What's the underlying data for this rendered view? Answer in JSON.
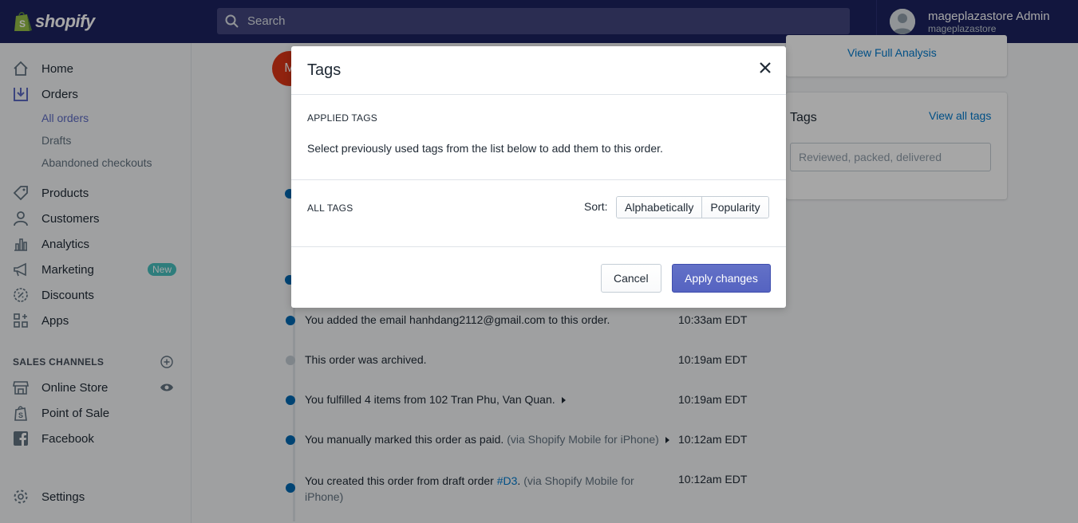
{
  "topbar": {
    "brand": "shopify",
    "search_placeholder": "Search",
    "user_name": "mageplazastore Admin",
    "user_shop": "mageplazastore"
  },
  "sidebar": {
    "items": [
      {
        "label": "Home",
        "icon": "home-icon"
      },
      {
        "label": "Orders",
        "icon": "orders-icon"
      },
      {
        "label": "Products",
        "icon": "products-icon"
      },
      {
        "label": "Customers",
        "icon": "customers-icon"
      },
      {
        "label": "Analytics",
        "icon": "analytics-icon"
      },
      {
        "label": "Marketing",
        "icon": "marketing-icon",
        "badge": "New"
      },
      {
        "label": "Discounts",
        "icon": "discounts-icon"
      },
      {
        "label": "Apps",
        "icon": "apps-icon"
      }
    ],
    "orders_sub": [
      "All orders",
      "Drafts",
      "Abandoned checkouts"
    ],
    "sales_channels_title": "SALES CHANNELS",
    "channels": [
      {
        "label": "Online Store",
        "icon": "online-store-icon"
      },
      {
        "label": "Point of Sale",
        "icon": "point-of-sale-icon"
      },
      {
        "label": "Facebook",
        "icon": "facebook-icon"
      }
    ],
    "settings": "Settings"
  },
  "background": {
    "avatar_letter": "M",
    "view_full_analysis": "View Full Analysis",
    "tags_card": {
      "title": "Tags",
      "view_all": "View all tags",
      "placeholder": "Reviewed, packed, delivered"
    },
    "timeline": [
      {
        "text": "You added the email hanhdang2112@gmail.com to this order.",
        "time": "10:33am EDT"
      },
      {
        "text": "This order was archived.",
        "time": "10:19am EDT"
      },
      {
        "text": "You fulfilled 4 items from 102 Tran Phu, Van Quan.",
        "time": "10:19am EDT"
      },
      {
        "text": "You manually marked this order as paid.",
        "suffix": "(via Shopify Mobile for iPhone)",
        "time": "10:12am EDT"
      },
      {
        "text_a": "You created this order from draft order ",
        "link": "#D3",
        "text_b": ". ",
        "suffix": "(via Shopify Mobile for iPhone)",
        "time": "10:12am EDT"
      }
    ]
  },
  "modal": {
    "title": "Tags",
    "applied_label": "APPLIED TAGS",
    "applied_help": "Select previously used tags from the list below to add them to this order.",
    "all_label": "ALL TAGS",
    "sort_label": "Sort:",
    "sort_options": [
      "Alphabetically",
      "Popularity"
    ],
    "cancel": "Cancel",
    "apply": "Apply changes"
  },
  "colors": {
    "topbar": "#1c2260",
    "accent": "#5c6ac4",
    "link": "#007ace",
    "timeline_dot": "#0069b3",
    "badge_new": "#47c1bf"
  }
}
